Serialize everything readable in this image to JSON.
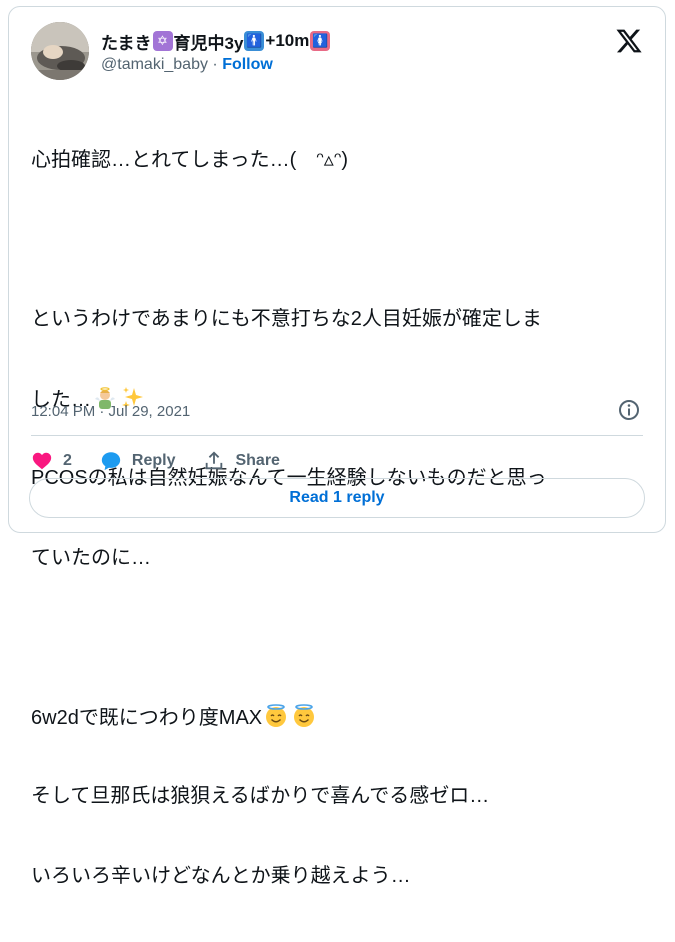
{
  "user": {
    "display_name": "たまき",
    "badge1": "✡",
    "name_part2": "育児中3y",
    "badge2": "🚹",
    "name_part3": "+10m",
    "badge3": "🚺",
    "handle": "@tamaki_baby",
    "separator": " · ",
    "follow_label": "Follow"
  },
  "tweet": {
    "lines": [
      "心拍確認…とれてしまった…(　ᵔ▵ᵔ)",
      "",
      "というわけであまりにも不意打ちな2人目妊娠が確定しま",
      "した…",
      "PCOSの私は自然妊娠なんて一生経験しないものだと思っ",
      "ていたのに…",
      "",
      "6w2dで既につわり度MAX",
      "そして旦那氏は狼狽えるばかりで喜んでる感ゼロ…",
      "いろいろ辛いけどなんとか乗り越えよう…"
    ],
    "timestamp": "12:04 PM · Jul 29, 2021"
  },
  "icons": {
    "x_logo": "x-logo-icon",
    "info": "info-icon",
    "like": "heart-icon",
    "reply": "reply-bubble-icon",
    "share": "share-icon",
    "angel": "angel-emoji",
    "sparkles": "sparkles-emoji",
    "halo_face": "halo-face-emoji"
  },
  "actions": {
    "like_count": "2",
    "reply_label": "Reply",
    "share_label": "Share"
  },
  "read_reply_label": "Read 1 reply",
  "colors": {
    "link": "#006fd6",
    "muted": "#536471",
    "heart": "#f91880",
    "reply_icon": "#1d9bf0",
    "border": "#cfd9de"
  }
}
